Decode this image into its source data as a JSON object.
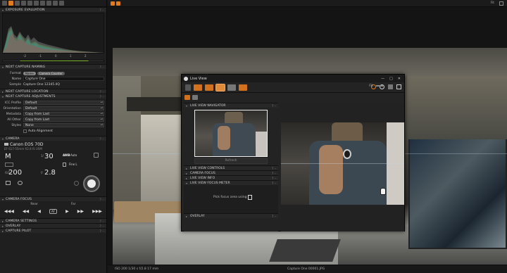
{
  "left_panel": {
    "sections": {
      "exposure": "EXPOSURE EVALUATION",
      "naming": "NEXT CAPTURE NAMING",
      "location": "NEXT CAPTURE LOCATION",
      "adjustments": "NEXT CAPTURE ADJUSTMENTS",
      "camera": "CAMERA",
      "focus": "CAMERA FOCUS",
      "settings": "CAMERA SETTINGS",
      "overlay": "OVERLAY",
      "pilot": "CAPTURE PILOT"
    },
    "ev_scale": [
      "-2",
      "-1",
      "0",
      "1",
      "2"
    ],
    "naming": {
      "format_label": "Format",
      "format_tokens": [
        "Name",
        "Camera Counter"
      ],
      "name_label": "Name",
      "name_value": "Capture One",
      "sample_label": "Sample",
      "sample_value": "Capture One 12345.IIQ"
    },
    "adjustments": {
      "rows": [
        {
          "label": "ICC Profile",
          "value": "Default"
        },
        {
          "label": "Orientation",
          "value": "Default"
        },
        {
          "label": "Metadata",
          "value": "Copy from Last"
        },
        {
          "label": "All Other",
          "value": "Copy from Last"
        },
        {
          "label": "Styles",
          "value": "None"
        }
      ],
      "auto_alignment": "Auto Alignment"
    },
    "camera": {
      "name": "Canon EOS 70D",
      "lens": "EF-S17-55mm f/2.8 IS USM",
      "mode": "M",
      "shutter": "30",
      "shutter_prefix": "1/",
      "wb_label": "AWB",
      "wb_value": "Auto",
      "quality": "Fine L",
      "iso": "200",
      "iso_label": "ISO",
      "aperture": "2.8",
      "aperture_prefix": "f/"
    },
    "focus": {
      "near": "Near",
      "far": "Far",
      "af": "AF"
    }
  },
  "topbar": {
    "fit": "Fit"
  },
  "statusbar": {
    "exposure": "ISO 200 1/30 s f/2.8 17 mm",
    "filename": "Capture One 00001.JPG"
  },
  "live_view": {
    "title": "Live View",
    "controls": [
      "—",
      "□",
      "✕"
    ],
    "fit": "Fit",
    "navigator": "LIVE VIEW NAVIGATOR",
    "refresh": "Refresh",
    "sections": [
      "LIVE VIEW CONTROLS",
      "CAMERA FOCUS",
      "LIVE VIEW INFO",
      "LIVE VIEW FOCUS METER"
    ],
    "meter_text": "Pick focus area using",
    "overlay": "OVERLAY"
  },
  "colors": {
    "accent": "#e07b20",
    "panel": "#1f1f1f"
  }
}
